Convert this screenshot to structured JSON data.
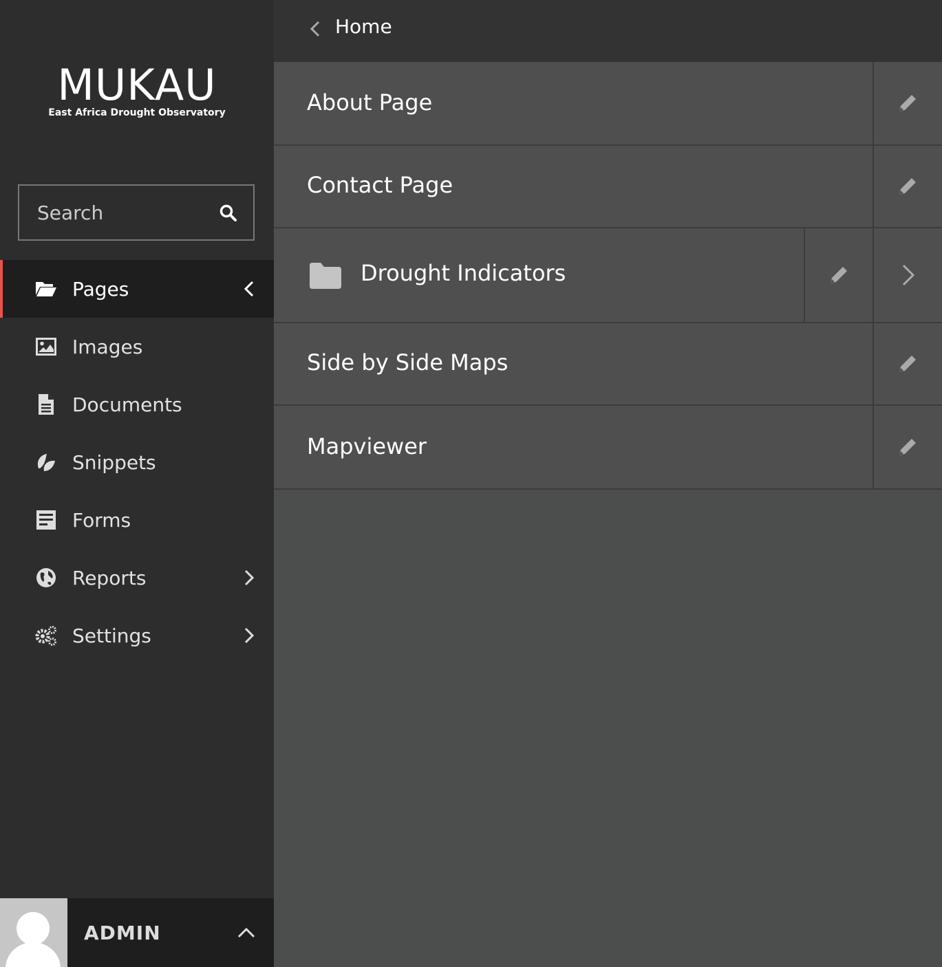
{
  "brand": {
    "title": "MUKAU",
    "subtitle": "East Africa Drought Observatory"
  },
  "search": {
    "placeholder": "Search"
  },
  "menu": {
    "items": [
      {
        "label": "Pages",
        "icon": "folder-open-icon",
        "active": true
      },
      {
        "label": "Images",
        "icon": "image-icon"
      },
      {
        "label": "Documents",
        "icon": "document-icon"
      },
      {
        "label": "Snippets",
        "icon": "snippet-icon"
      },
      {
        "label": "Forms",
        "icon": "form-icon"
      },
      {
        "label": "Reports",
        "icon": "globe-icon"
      },
      {
        "label": "Settings",
        "icon": "cogs-icon"
      }
    ]
  },
  "account": {
    "name": "ADMIN"
  },
  "header": {
    "title": "Home"
  },
  "pages": [
    {
      "title": "About Page"
    },
    {
      "title": "Contact Page"
    },
    {
      "title": "Drought Indicators"
    },
    {
      "title": "Side by Side Maps"
    },
    {
      "title": "Mapviewer"
    }
  ],
  "colors": {
    "accent": "#e9524a",
    "sidebar": "#2d2d2d",
    "main": "#4c4d4d"
  }
}
